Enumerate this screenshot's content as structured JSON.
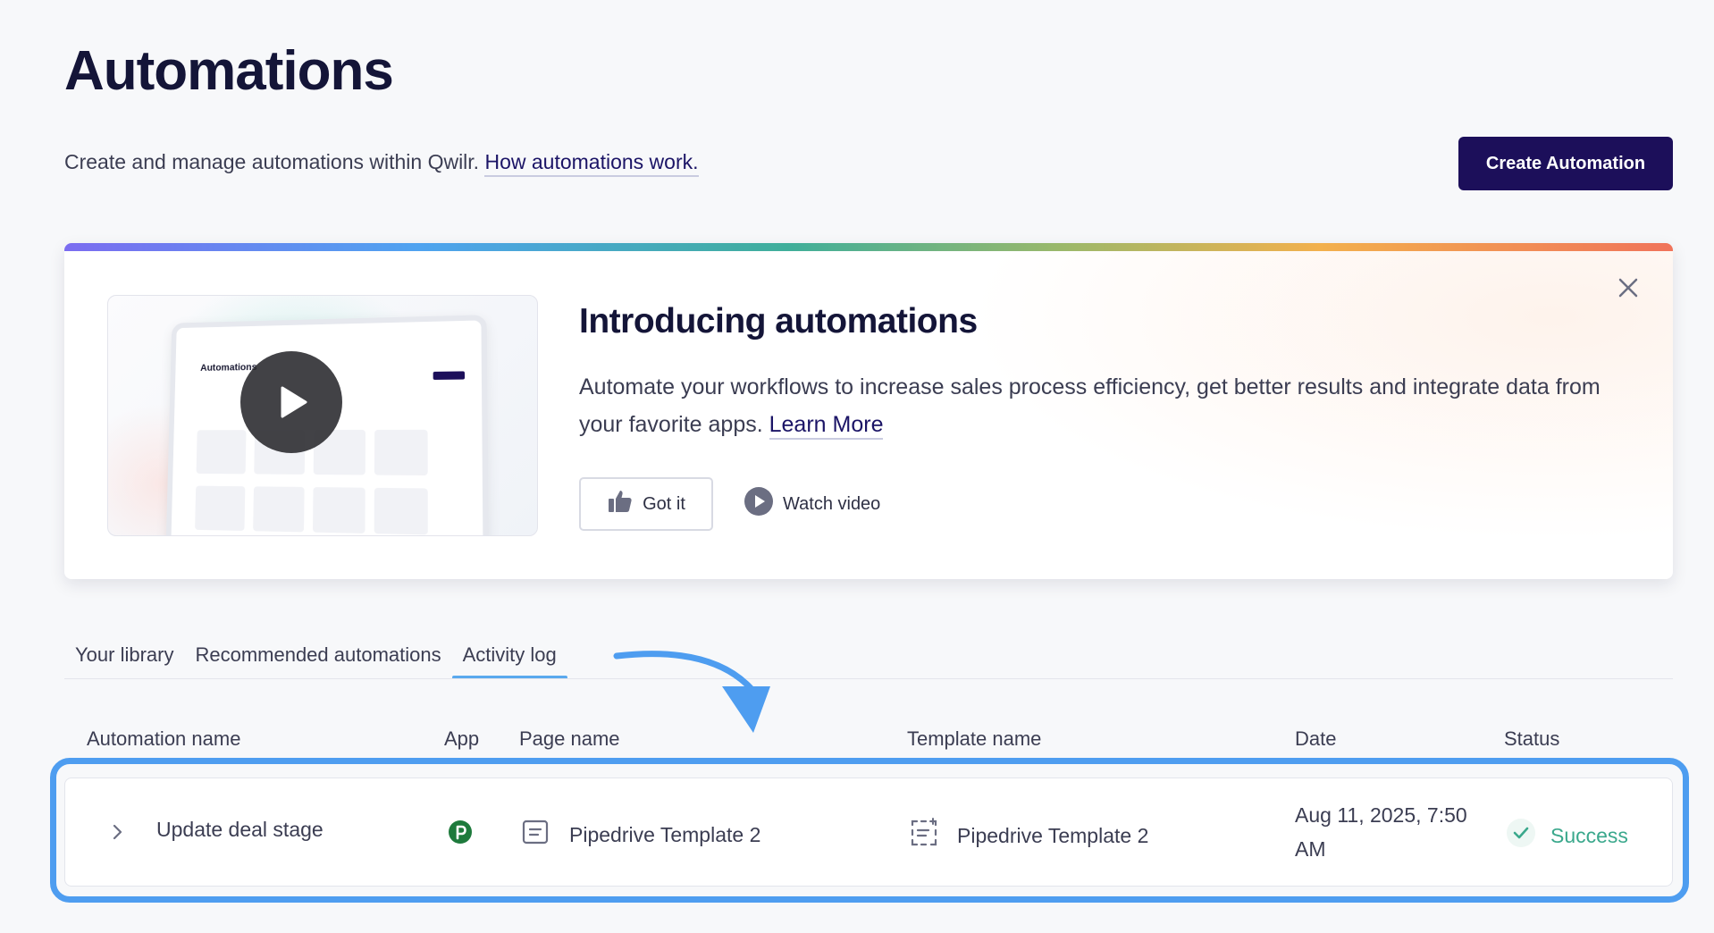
{
  "header": {
    "title": "Automations",
    "subtitle": "Create and manage automations within Qwilr.",
    "subtitle_link": "How automations work.",
    "create_button": "Create Automation"
  },
  "intro": {
    "title": "Introducing automations",
    "description": "Automate your workflows to increase sales process efficiency, get better results and integrate data from your favorite apps.",
    "learn_more": "Learn More",
    "got_it": "Got it",
    "watch_video": "Watch video",
    "thumbnail_title": "Automations"
  },
  "tabs": [
    {
      "label": "Your library",
      "active": false
    },
    {
      "label": "Recommended automations",
      "active": false
    },
    {
      "label": "Activity log",
      "active": true
    }
  ],
  "table": {
    "columns": [
      "Automation name",
      "App",
      "Page name",
      "Template name",
      "Date",
      "Status"
    ],
    "rows": [
      {
        "automation_name": "Update deal stage",
        "app": "pipedrive-icon",
        "page_name": "Pipedrive Template 2",
        "template_name": "Pipedrive Template 2",
        "date": "Aug 11, 2025, 7:50 AM",
        "status": "Success"
      }
    ]
  },
  "colors": {
    "brand": "#1c0f5a",
    "highlight": "#4e9df0",
    "success": "#3aa88c",
    "pipedrive": "#1e7a3c"
  }
}
